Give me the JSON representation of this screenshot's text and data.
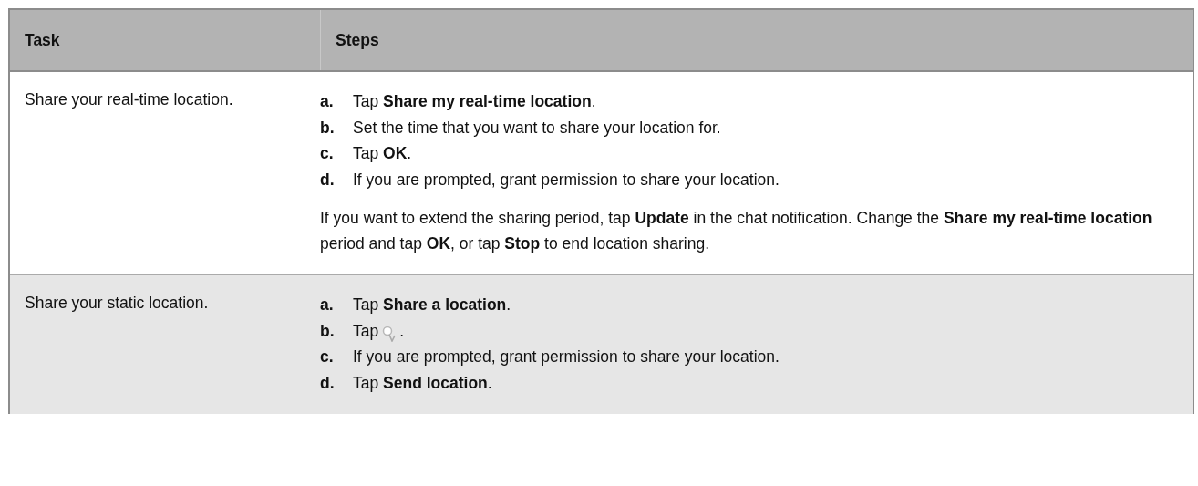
{
  "table": {
    "columns": [
      "Task",
      "Steps"
    ],
    "rows": [
      {
        "task": "Share your real-time location.",
        "shaded": false,
        "steps": [
          {
            "letter": "a.",
            "parts": [
              {
                "kind": "text",
                "text": "Tap **Share my real-time location**."
              }
            ]
          },
          {
            "letter": "b.",
            "parts": [
              {
                "kind": "text",
                "text": "Set the time that you want to share your location for."
              }
            ]
          },
          {
            "letter": "c.",
            "parts": [
              {
                "kind": "text",
                "text": "Tap **OK**."
              }
            ]
          },
          {
            "letter": "d.",
            "parts": [
              {
                "kind": "text",
                "text": "If you are prompted, grant permission to share your location."
              }
            ]
          }
        ],
        "note": "If you want to extend the sharing period, tap **Update** in the chat notification. Change the **Share my real-time location** period and tap **OK**, or tap **Stop** to end location sharing."
      },
      {
        "task": "Share your static location.",
        "shaded": true,
        "steps": [
          {
            "letter": "a.",
            "parts": [
              {
                "kind": "text",
                "text": "Tap **Share a location**."
              }
            ]
          },
          {
            "letter": "b.",
            "parts": [
              {
                "kind": "text",
                "text": "Tap"
              },
              {
                "kind": "icon"
              },
              {
                "kind": "text",
                "text": "."
              }
            ]
          },
          {
            "letter": "c.",
            "parts": [
              {
                "kind": "text",
                "text": "If you are prompted, grant permission to share your location."
              }
            ]
          },
          {
            "letter": "d.",
            "parts": [
              {
                "kind": "text",
                "text": "Tap **Send location**."
              }
            ]
          }
        ]
      }
    ]
  }
}
